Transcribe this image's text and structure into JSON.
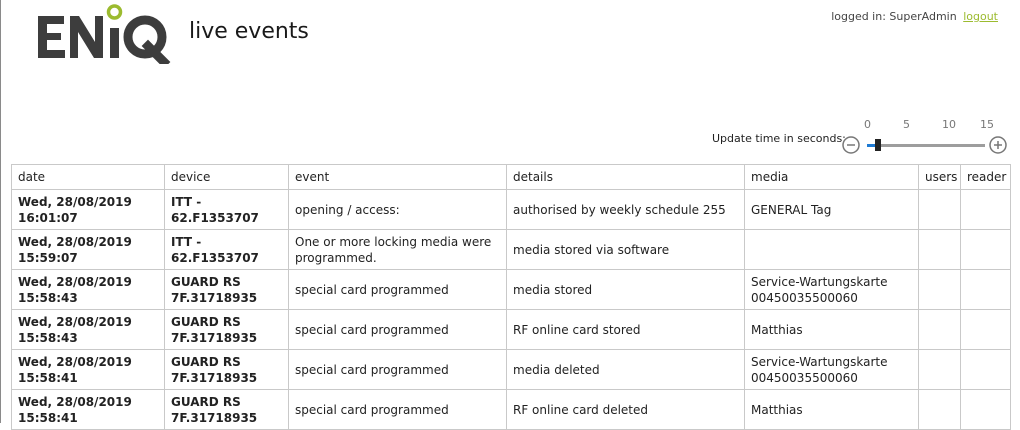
{
  "header": {
    "app_title": "live events",
    "logged_in_label": "logged in: SuperAdmin",
    "logout_label": "logout"
  },
  "update": {
    "label": "Update time in seconds:",
    "ticks": [
      "0",
      "5",
      "10",
      "15"
    ],
    "min": 0,
    "max": 15,
    "value": 1
  },
  "table": {
    "columns": [
      "date",
      "device",
      "event",
      "details",
      "media",
      "users",
      "reader"
    ],
    "rows": [
      {
        "date": "Wed, 28/08/2019",
        "time": "16:01:07",
        "device": "ITT - 62.F1353707",
        "device2": "",
        "event": "opening / access:",
        "details": "authorised by weekly schedule 255",
        "media": "GENERAL Tag",
        "media2": "",
        "users": "",
        "reader": ""
      },
      {
        "date": "Wed, 28/08/2019",
        "time": "15:59:07",
        "device": "ITT - 62.F1353707",
        "device2": "",
        "event": "One or more locking media were programmed.",
        "details": "media stored via software",
        "media": "",
        "media2": "",
        "users": "",
        "reader": ""
      },
      {
        "date": "Wed, 28/08/2019",
        "time": "15:58:43",
        "device": "GUARD RS",
        "device2": "7F.31718935",
        "event": "special card programmed",
        "details": "media stored",
        "media": "Service-Wartungskarte",
        "media2": "00450035500060",
        "users": "",
        "reader": ""
      },
      {
        "date": "Wed, 28/08/2019",
        "time": "15:58:43",
        "device": "GUARD RS",
        "device2": "7F.31718935",
        "event": "special card programmed",
        "details": "RF online card stored",
        "media": "Matthias",
        "media2": "",
        "users": "",
        "reader": ""
      },
      {
        "date": "Wed, 28/08/2019",
        "time": "15:58:41",
        "device": "GUARD RS",
        "device2": "7F.31718935",
        "event": "special card programmed",
        "details": "media deleted",
        "media": "Service-Wartungskarte",
        "media2": "00450035500060",
        "users": "",
        "reader": ""
      },
      {
        "date": "Wed, 28/08/2019",
        "time": "15:58:41",
        "device": "GUARD RS",
        "device2": "7F.31718935",
        "event": "special card programmed",
        "details": "RF online card deleted",
        "media": "Matthias",
        "media2": "",
        "users": "",
        "reader": ""
      }
    ]
  },
  "colors": {
    "logo_text": "#3d3d3d",
    "logo_accent": "#9cbb2f",
    "link": "#9cbb2f",
    "grid": "#c9c9c9"
  }
}
